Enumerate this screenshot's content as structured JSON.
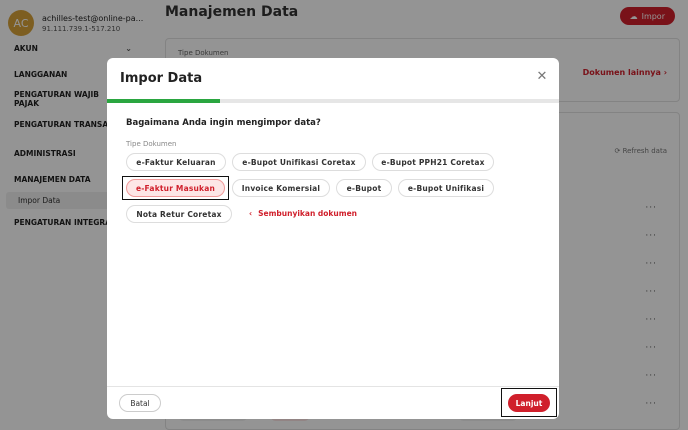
{
  "sidebar": {
    "avatar_initials": "AC",
    "user_email": "achilles-test@online-pa...",
    "user_phone": "91.111.739.1-517.210",
    "items": [
      {
        "label": "AKUN"
      },
      {
        "label": "LANGGANAN"
      },
      {
        "label": "PENGATURAN WAJIB PAJAK"
      },
      {
        "label": "PENGATURAN TRANSAKSI"
      },
      {
        "label": "ADMINISTRASI"
      },
      {
        "label": "MANAJEMEN DATA"
      },
      {
        "label": "Impor Data"
      },
      {
        "label": "PENGATURAN INTEGRASI"
      }
    ]
  },
  "header": {
    "title": "Manajemen Data",
    "import_label": "Impor"
  },
  "background": {
    "doc_type_label": "Tipe Dokumen",
    "other_docs_link": "Dokumen lainnya",
    "refresh_label": "Refresh data"
  },
  "modal": {
    "title": "Impor Data",
    "progress": 0.25,
    "question": "Bagaimana Anda ingin mengimpor data?",
    "doc_type_label": "Tipe Dokumen",
    "chips": [
      {
        "label": "e-Faktur Keluaran",
        "selected": false
      },
      {
        "label": "e-Bupot Unifikasi Coretax",
        "selected": false
      },
      {
        "label": "e-Bupot PPH21 Coretax",
        "selected": false
      },
      {
        "label": "e-Faktur Masukan",
        "selected": true
      },
      {
        "label": "Invoice Komersial",
        "selected": false
      },
      {
        "label": "e-Bupot",
        "selected": false
      },
      {
        "label": "e-Bupot Unifikasi",
        "selected": false
      },
      {
        "label": "Nota Retur Coretax",
        "selected": false
      }
    ],
    "hide_docs_label": "Sembunyikan dokumen",
    "cancel_label": "Batal",
    "next_label": "Lanjut"
  },
  "colors": {
    "accent": "#d01f2b",
    "progress": "#2aa640",
    "avatar": "#d7a23a"
  }
}
